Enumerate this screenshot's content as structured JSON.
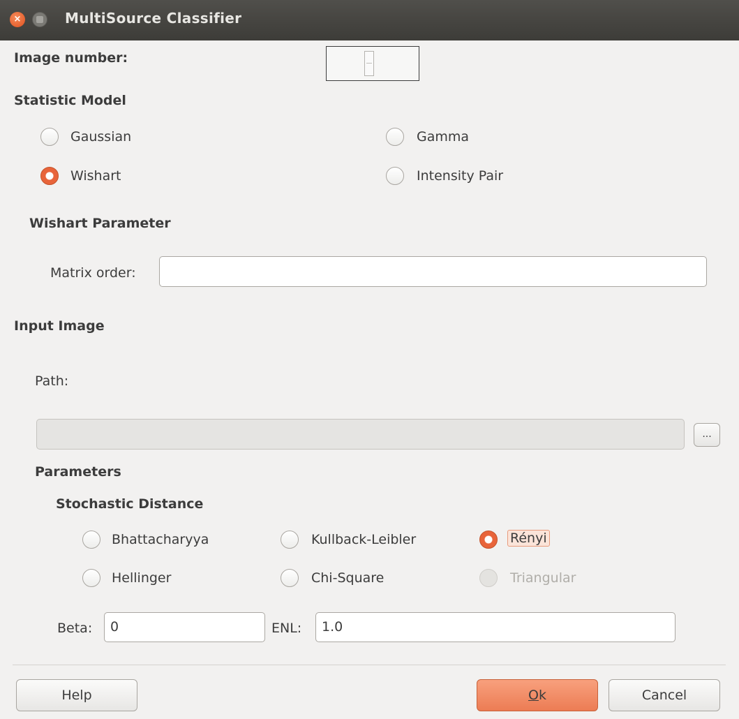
{
  "window": {
    "title": "MultiSource Classifier"
  },
  "image_number": {
    "label": "Image number:",
    "value": ""
  },
  "statistic_model": {
    "heading": "Statistic Model",
    "options": [
      {
        "label": "Gaussian",
        "checked": false
      },
      {
        "label": "Gamma",
        "checked": false
      },
      {
        "label": "Wishart",
        "checked": true
      },
      {
        "label": "Intensity Pair",
        "checked": false
      }
    ]
  },
  "wishart_parameter": {
    "heading": "Wishart Parameter",
    "matrix_order_label": "Matrix order:",
    "matrix_order_value": ""
  },
  "input_image": {
    "heading": "Input Image",
    "path_label": "Path:",
    "path_value": "",
    "browse_label": "..."
  },
  "parameters": {
    "heading": "Parameters",
    "stochastic_distance": {
      "heading": "Stochastic Distance",
      "options": [
        {
          "label": "Bhattacharyya",
          "checked": false,
          "enabled": true
        },
        {
          "label": "Kullback-Leibler",
          "checked": false,
          "enabled": true
        },
        {
          "label": "Rényi",
          "checked": true,
          "enabled": true
        },
        {
          "label": "Hellinger",
          "checked": false,
          "enabled": true
        },
        {
          "label": "Chi-Square",
          "checked": false,
          "enabled": true
        },
        {
          "label": "Triangular",
          "checked": false,
          "enabled": false
        }
      ]
    },
    "beta_label": "Beta:",
    "beta_value": "0",
    "enl_label": "ENL:",
    "enl_value": "1.0"
  },
  "buttons": {
    "help": "Help",
    "ok_mnemonic": "O",
    "ok_rest": "k",
    "cancel": "Cancel"
  },
  "colors": {
    "accent": "#e8643a",
    "titlebar": "#3d3c38",
    "background": "#f2f1f0"
  }
}
